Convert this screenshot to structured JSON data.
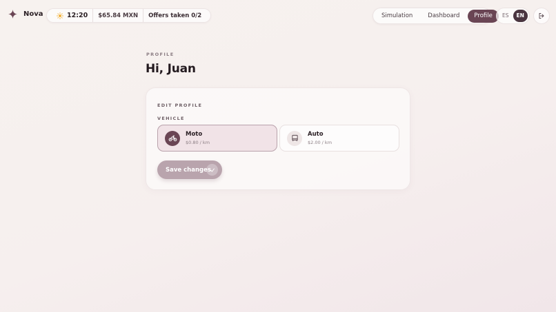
{
  "header": {
    "brand_name": "Nova",
    "status": {
      "time": "12:20",
      "balance": "$65.84 MXN",
      "offers": "Offers taken 0/2"
    },
    "nav": {
      "tabs": [
        {
          "label": "Simulation",
          "active": false
        },
        {
          "label": "Dashboard",
          "active": false
        },
        {
          "label": "Profile",
          "active": true
        }
      ]
    },
    "language": {
      "options": [
        {
          "label": "ES",
          "active": false
        },
        {
          "label": "EN",
          "active": true
        }
      ]
    },
    "icons": {
      "brand": "sparkle-icon",
      "weather": "sun-icon",
      "logout": "logout-icon"
    }
  },
  "page": {
    "eyebrow": "PROFILE",
    "greeting": "Hi, Juan"
  },
  "edit_profile": {
    "section_title": "EDIT PROFILE",
    "vehicle_label": "VEHICLE",
    "vehicles": [
      {
        "name": "Moto",
        "price": "$0.80 / km",
        "selected": true,
        "icon": "motorcycle-icon"
      },
      {
        "name": "Auto",
        "price": "$2.00 / km",
        "selected": false,
        "icon": "car-icon"
      }
    ],
    "save_label": "Save changes",
    "save_icon": "check-icon"
  },
  "colors": {
    "accent": "#6a4554",
    "selected_bg": "#f1e3e7",
    "button_disabled": "#b9a4ad"
  }
}
